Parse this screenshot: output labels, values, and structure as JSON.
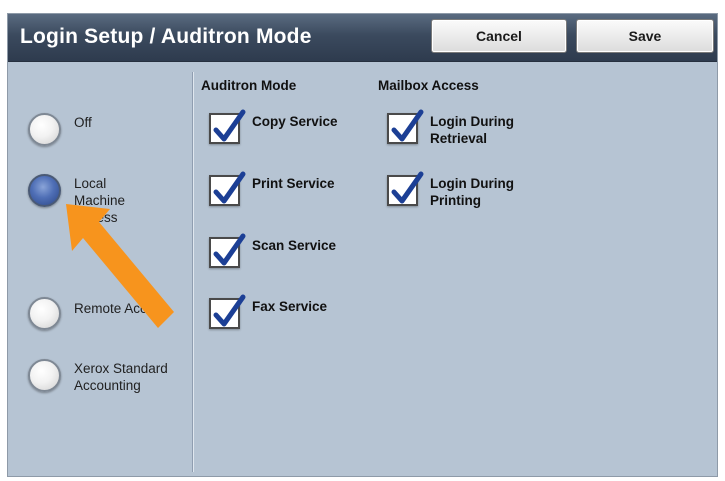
{
  "header": {
    "title": "Login Setup / Auditron Mode",
    "cancel_label": "Cancel",
    "save_label": "Save"
  },
  "login_options": [
    {
      "label": "Off",
      "selected": false
    },
    {
      "label": "Local Machine Access",
      "selected": true
    },
    {
      "label": "Remote Access",
      "selected": false
    },
    {
      "label": "Xerox Standard Accounting",
      "selected": false
    }
  ],
  "auditron_mode": {
    "heading": "Auditron Mode",
    "items": [
      {
        "label": "Copy Service",
        "checked": true
      },
      {
        "label": "Print Service",
        "checked": true
      },
      {
        "label": "Scan Service",
        "checked": true
      },
      {
        "label": "Fax Service",
        "checked": true
      }
    ]
  },
  "mailbox_access": {
    "heading": "Mailbox Access",
    "items": [
      {
        "label": "Login During Retrieval",
        "checked": true
      },
      {
        "label": "Login During Printing",
        "checked": true
      }
    ]
  },
  "colors": {
    "panel": "#b6c4d3",
    "titlebar": "#3b4a5e",
    "arrow": "#f7941d",
    "selected_radio": "#4f6fb6"
  }
}
